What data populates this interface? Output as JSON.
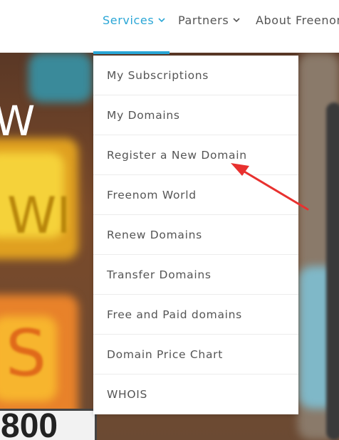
{
  "nav": {
    "items": [
      {
        "label": "Services",
        "active": true
      },
      {
        "label": "Partners",
        "active": false
      },
      {
        "label": "About Freenom",
        "active": false
      }
    ]
  },
  "dropdown": {
    "items": [
      {
        "label": "My Subscriptions"
      },
      {
        "label": "My Domains"
      },
      {
        "label": "Register a New Domain"
      },
      {
        "label": "Freenom World"
      },
      {
        "label": "Renew Domains"
      },
      {
        "label": "Transfer Domains"
      },
      {
        "label": "Free and Paid domains"
      },
      {
        "label": "Domain Price Chart"
      },
      {
        "label": "WHOIS"
      }
    ]
  },
  "hero": {
    "partial_heading": "W",
    "sign_text_1": "WI",
    "sign_text_2": "S",
    "plate_text": "800"
  },
  "annotation": {
    "type": "red-arrow",
    "target": "Register a New Domain",
    "color": "#e8312f"
  },
  "colors": {
    "accent": "#2aa6d6",
    "text": "#555555",
    "divider": "#ececec"
  }
}
